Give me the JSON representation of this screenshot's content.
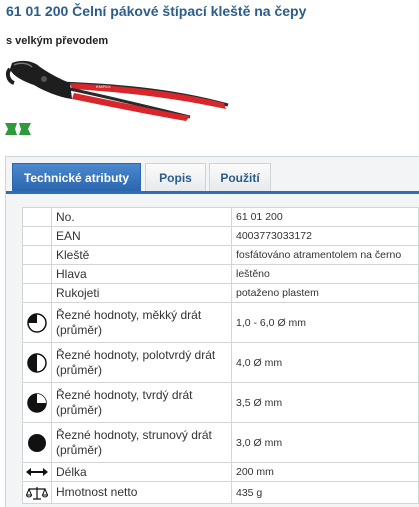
{
  "product": {
    "title": "61 01 200 Čelní pákové štípací kleště na čepy",
    "subtitle": "s velkým převodem"
  },
  "colors": {
    "title": "#2b5d8c",
    "handle_red": "#d8262d",
    "tab_active": "#2f6db5",
    "badge_green": "#2e9a3e"
  },
  "tabs": [
    {
      "label": "Technické atributy",
      "active": true
    },
    {
      "label": "Popis",
      "active": false
    },
    {
      "label": "Použití",
      "active": false
    }
  ],
  "specs": [
    {
      "icon": "",
      "label": "No.",
      "value": "61 01 200"
    },
    {
      "icon": "",
      "label": "EAN",
      "value": "4003773033172"
    },
    {
      "icon": "",
      "label": "Kleště",
      "value": "fosfátováno atramentolem na černo"
    },
    {
      "icon": "",
      "label": "Hlava",
      "value": "leštěno"
    },
    {
      "icon": "",
      "label": "Rukojeti",
      "value": "potaženo plastem"
    },
    {
      "icon": "quarter-circle-icon",
      "label": "Řezné hodnoty, měkký drát (průměr)",
      "value": "1,0 - 6,0 Ø mm"
    },
    {
      "icon": "half-circle-icon",
      "label": "Řezné hodnoty, polotvrdý drát (průměr)",
      "value": "4,0 Ø mm"
    },
    {
      "icon": "three-quarter-circle-icon",
      "label": "Řezné hodnoty, tvrdý drát (průměr)",
      "value": "3,5 Ø mm"
    },
    {
      "icon": "full-circle-icon",
      "label": "Řezné hodnoty, strunový drát (průměr)",
      "value": "3,0 Ø mm"
    },
    {
      "icon": "length-arrow-icon",
      "label": "Délka",
      "value": "200 mm"
    },
    {
      "icon": "scale-icon",
      "label": "Hmotnost netto",
      "value": "435 g"
    }
  ]
}
